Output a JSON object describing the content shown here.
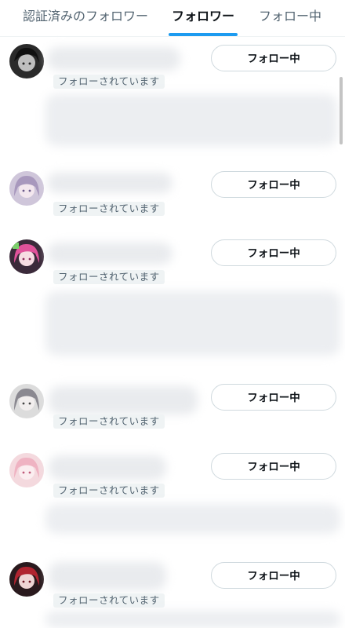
{
  "tabs": [
    {
      "label": "認証済みのフォロワー",
      "active": false
    },
    {
      "label": "フォロワー",
      "active": true
    },
    {
      "label": "フォロー中",
      "active": false
    }
  ],
  "accent_color": "#1d9bf0",
  "users": [
    {
      "follows_you_label": "フォローされています",
      "button_label": "フォロー中",
      "avatar": "dark-hair-avatar"
    },
    {
      "follows_you_label": "フォローされています",
      "button_label": "フォロー中",
      "avatar": "lavender-hair-avatar"
    },
    {
      "follows_you_label": "フォローされています",
      "button_label": "フォロー中",
      "avatar": "pink-hair-avatar"
    },
    {
      "follows_you_label": "フォローされています",
      "button_label": "フォロー中",
      "avatar": "grey-hair-avatar"
    },
    {
      "follows_you_label": "フォローされています",
      "button_label": "フォロー中",
      "avatar": "pastel-pink-avatar"
    },
    {
      "follows_you_label": "フォローされています",
      "button_label": "フォロー中",
      "avatar": "red-hair-avatar"
    }
  ]
}
